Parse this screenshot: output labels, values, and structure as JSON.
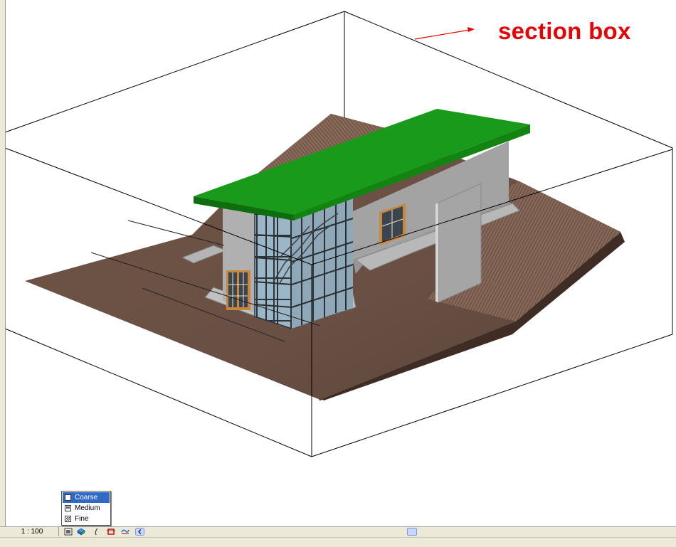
{
  "annotation": {
    "label": "section box"
  },
  "view_control_bar": {
    "scale": "1 : 100",
    "icons": [
      "detail-level-icon",
      "model-graphics-style-icon",
      "shadows-icon",
      "crop-region-icon",
      "show-crop-region-icon",
      "scroll-left-icon"
    ]
  },
  "detail_level_menu": {
    "items": [
      {
        "label": "Coarse",
        "selected": true
      },
      {
        "label": "Medium",
        "selected": false
      },
      {
        "label": "Fine",
        "selected": false
      }
    ]
  },
  "colors": {
    "annotation": "#e60000",
    "roof": "#1a9a1a",
    "terrain": "#6a5044",
    "walls": "#a8a8a8",
    "glazing": "#98b4c4",
    "menu_highlight": "#316ac5"
  }
}
